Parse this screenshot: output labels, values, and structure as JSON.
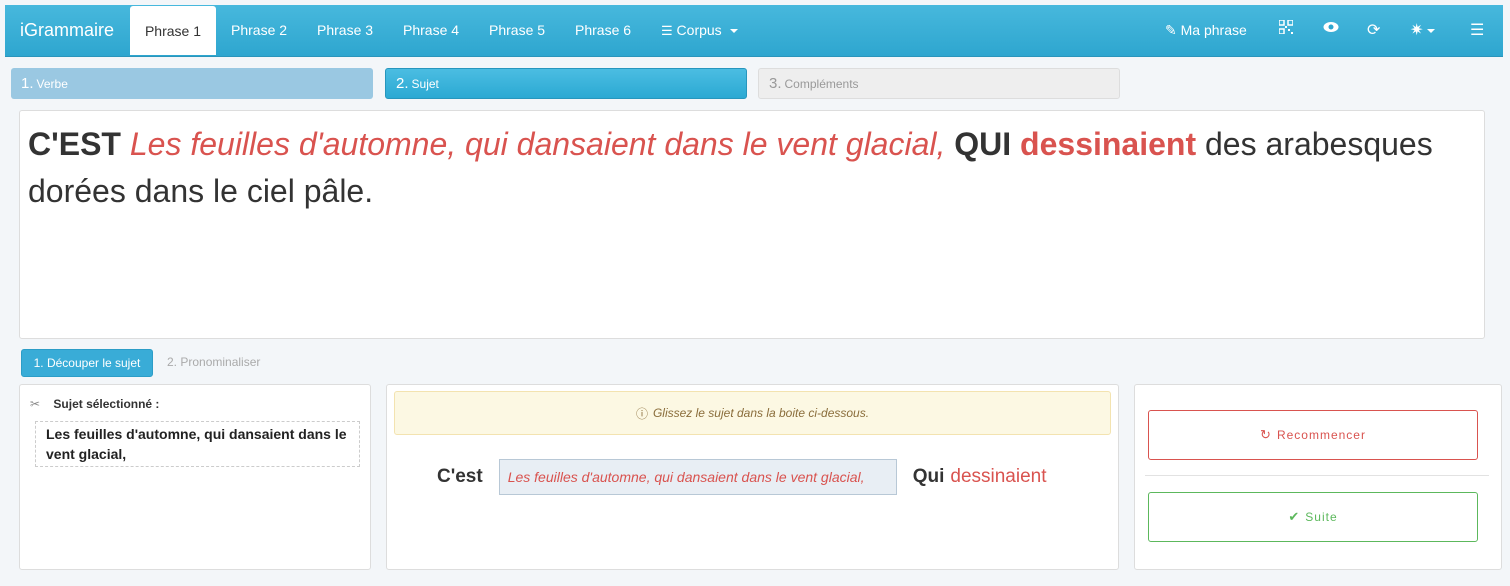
{
  "navbar": {
    "brand": "iGrammaire",
    "tabs": [
      {
        "label": "Phrase 1",
        "active": true
      },
      {
        "label": "Phrase 2"
      },
      {
        "label": "Phrase 3"
      },
      {
        "label": "Phrase 4"
      },
      {
        "label": "Phrase 5"
      },
      {
        "label": "Phrase 6"
      }
    ],
    "corpus_label": "Corpus",
    "ma_phrase_label": "Ma phrase",
    "icons": [
      "pencil-icon",
      "qrcode-icon",
      "eye-icon",
      "refresh-icon",
      "gear-icon",
      "menu-icon"
    ]
  },
  "steps": [
    {
      "num": "1.",
      "label": "Verbe"
    },
    {
      "num": "2.",
      "label": "Sujet"
    },
    {
      "num": "3.",
      "label": "Compléments"
    }
  ],
  "sentence": {
    "cest": "C'EST",
    "subject": "Les feuilles d'automne, qui dansaient dans le vent glacial,",
    "qui": "QUI",
    "verb": "dessinaient",
    "rest": "des arabesques dorées dans le ciel pâle."
  },
  "subtabs": {
    "active": "1. Découper le sujet",
    "inactive": "2. Pronominaliser"
  },
  "selected": {
    "title": "Sujet sélectionné :",
    "text": "Les feuilles d'automne, qui dansaient dans le vent glacial,"
  },
  "workspace": {
    "alert": "Glissez le sujet dans la boite ci-dessous.",
    "cest": "C'est",
    "dropped": "Les feuilles d'automne, qui dansaient dans le vent glacial,",
    "qui": "Qui",
    "verb": "dessinaient"
  },
  "actions": {
    "restart": "Recommencer",
    "next": "Suite"
  },
  "colors": {
    "navbar": "#2ea6cf",
    "danger": "#d9534f",
    "success": "#5cb85c",
    "warning_bg": "#fcf8e3"
  }
}
